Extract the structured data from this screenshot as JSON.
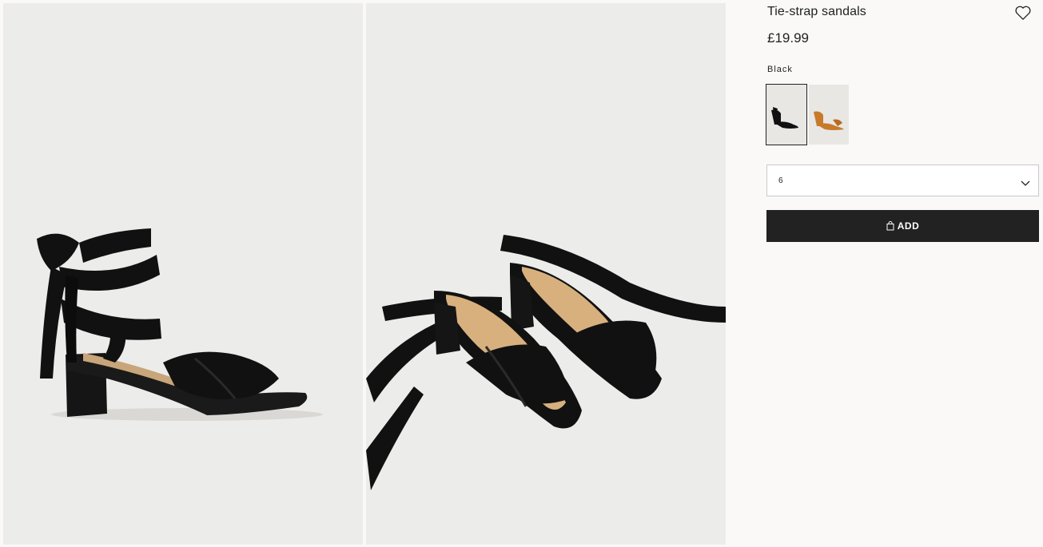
{
  "product": {
    "title": "Tie-strap sandals",
    "price": "£19.99",
    "favourite_icon": "heart-outline-icon"
  },
  "color": {
    "selected_name": "Black",
    "swatches": [
      {
        "name": "Black",
        "hex": "#111111",
        "selected": true
      },
      {
        "name": "Mustard",
        "hex": "#c77a2a",
        "selected": false
      }
    ]
  },
  "size": {
    "selected": "6",
    "icon": "chevron-down-icon"
  },
  "cart": {
    "add_label": "ADD",
    "icon": "shopping-bag-icon"
  },
  "images": [
    {
      "alt": "Side view of black tie-strap sandal"
    },
    {
      "alt": "Pair of black tie-strap sandals from above"
    }
  ],
  "colors": {
    "page_bg": "#faf9f8",
    "image_bg": "#ececea",
    "button_bg": "#222222",
    "text": "#222222"
  }
}
